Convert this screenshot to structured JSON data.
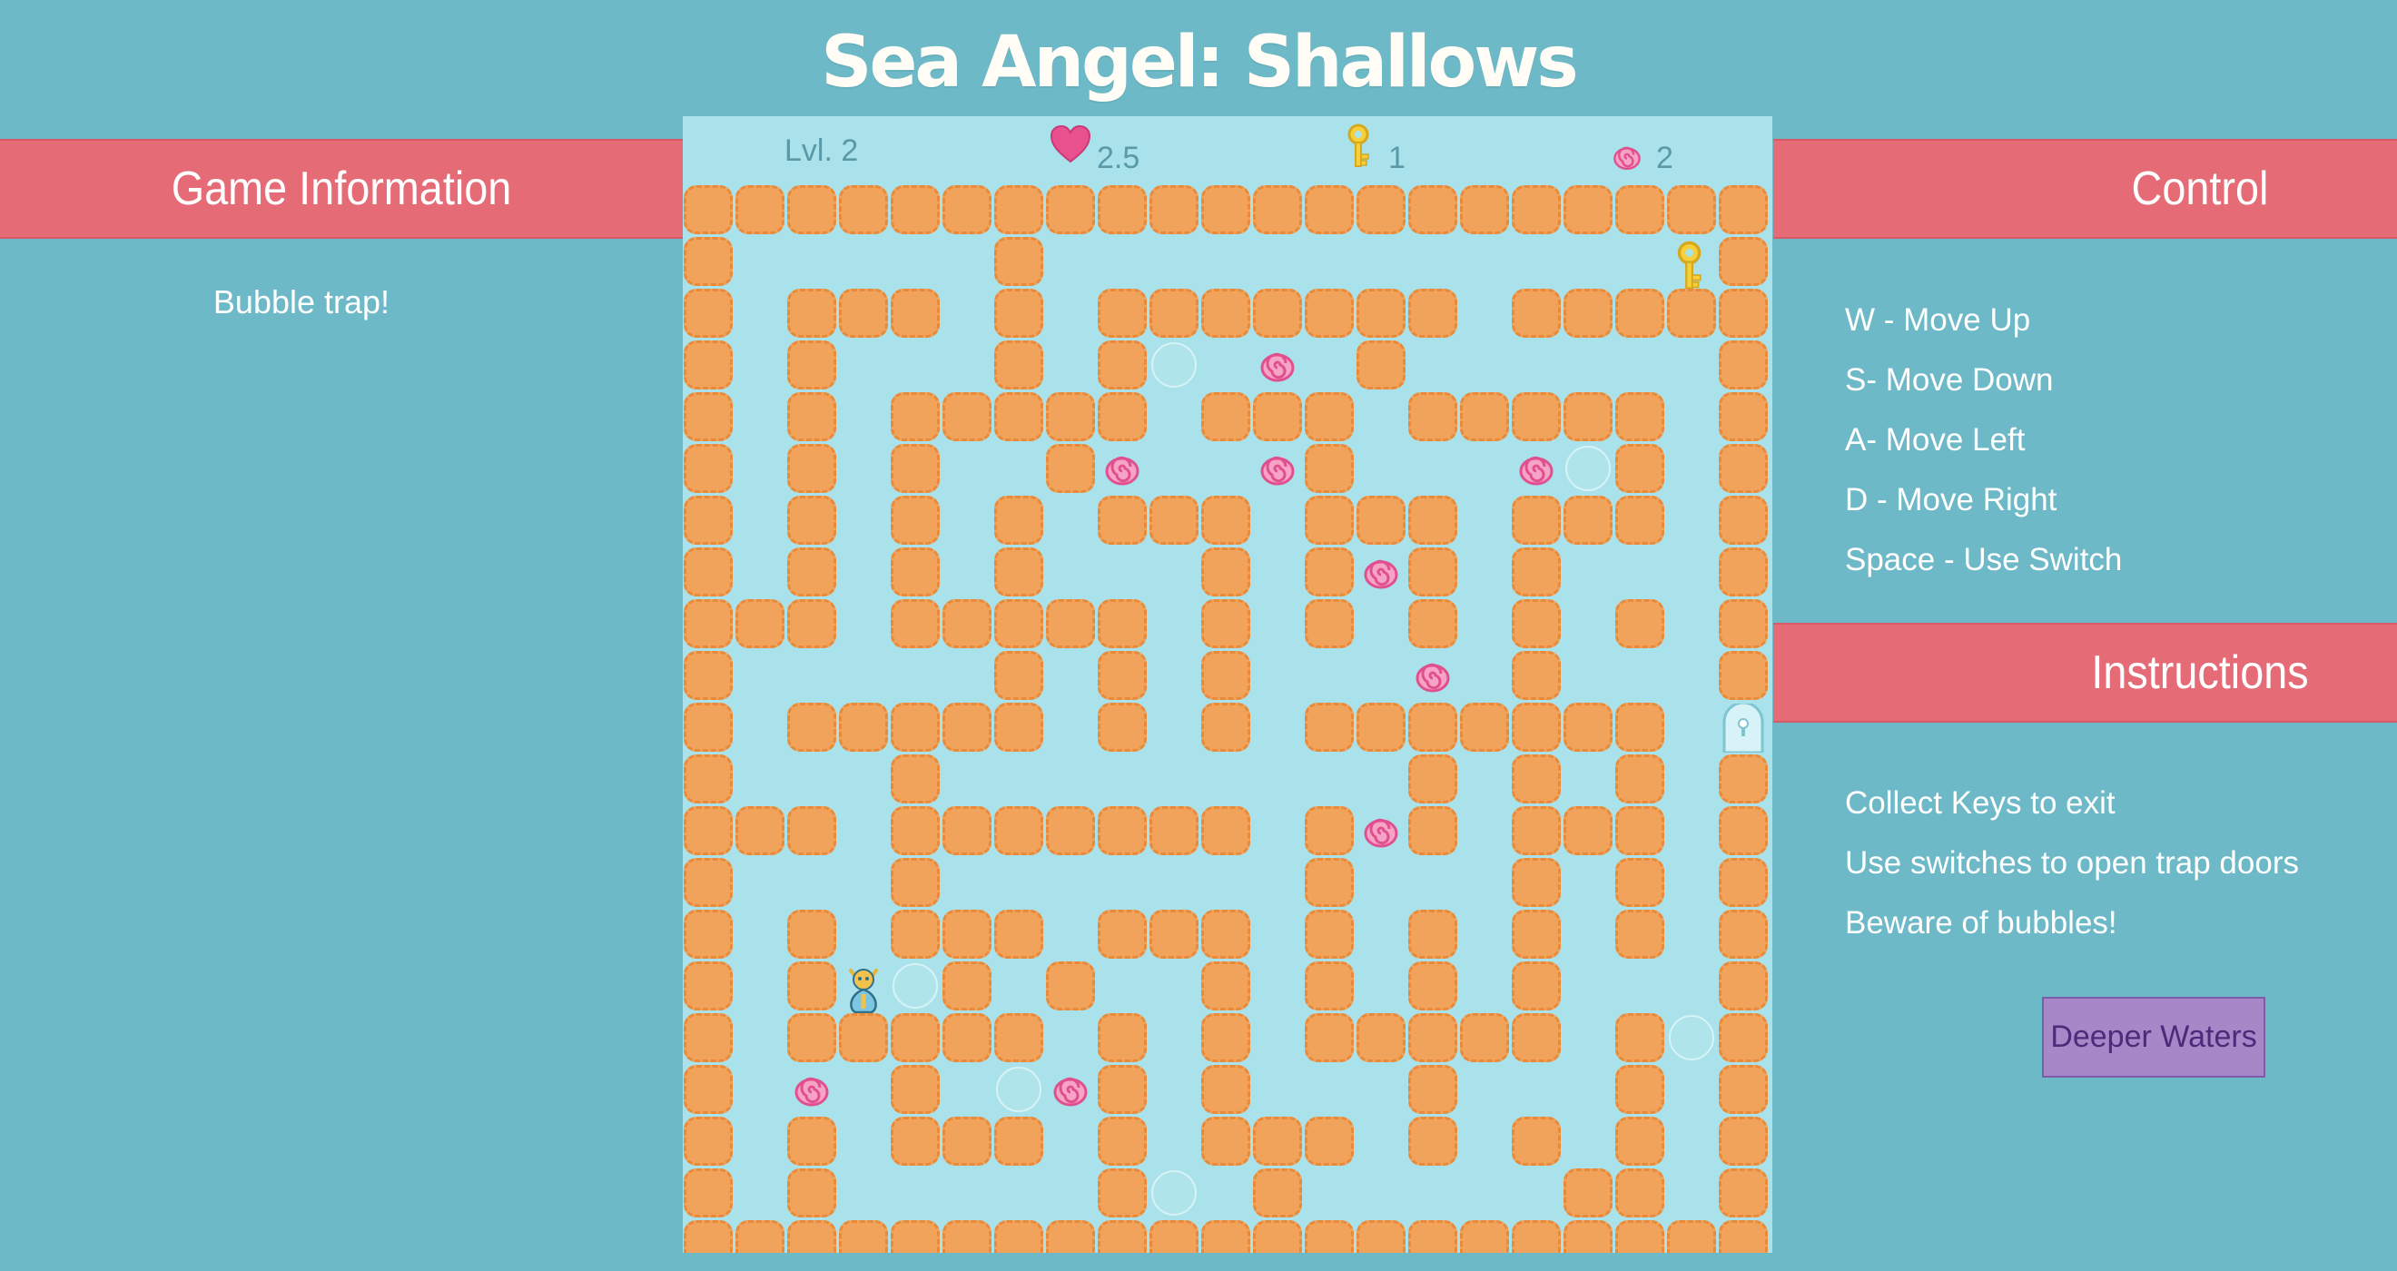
{
  "title": "Sea Angel: Shallows",
  "left_panel": {
    "heading": "Game Information",
    "message": "Bubble trap!"
  },
  "controls": {
    "heading": "Control",
    "items": [
      "W - Move Up",
      "S- Move Down",
      "A- Move Left",
      "D - Move Right",
      "Space - Use Switch"
    ]
  },
  "instructions": {
    "heading": "Instructions",
    "items": [
      "Collect Keys to exit",
      "Use switches to open trap doors",
      "Beware of bubbles!"
    ]
  },
  "next_button": "Deeper Waters",
  "hud": {
    "level": "Lvl. 2",
    "health": "2.5",
    "keys": "1",
    "shells": "2"
  },
  "colors": {
    "background": "#6db9c7",
    "banner": "#e56c77",
    "board_water": "#a9e2ea",
    "wall": "#f1a35c",
    "button": "#a787c8"
  },
  "icons": [
    "heart-icon",
    "key-icon",
    "shell-icon",
    "sea-angel-player",
    "bubble",
    "exit-door",
    "key-pickup"
  ],
  "maze": {
    "cols": 21,
    "rows": 21,
    "legend": {
      "#": "wall",
      ".": "water",
      "K": "key",
      "D": "exit door",
      "P": "player",
      "s": "shell",
      "o": "bubble"
    },
    "grid": [
      "#####################",
      "#.....#............K#",
      "#.###.#.#######.#####",
      "#.#...#.#o.s.#......#",
      "#.#.#####.###.#####.#",
      "#.#.#..#sx.s#...so#.#",
      "#.#.#.#.###.###.###.#",
      "#.#.#.#...#.#s#.#...#",
      "###.#####.#.#.#.#.#.#",
      "#.....#.#.#...s.#...#",
      "#.#####.#.#.#######.D",
      "#...#.........#.#.#.#",
      "###.#######.#s#.###.#",
      "#...#.......#...#.#.#",
      "#.#.###.###.#.#.#.#.#",
      "#.#Po#.#..#.#.#.#...#",
      "#.#####.#.#.#####.#o#",
      "#.s.#.os#.#...#...#.#",
      "#.#.###.#.###.#.#.#.#",
      "#.#.....#o.#.....##.#",
      "#####################"
    ]
  }
}
